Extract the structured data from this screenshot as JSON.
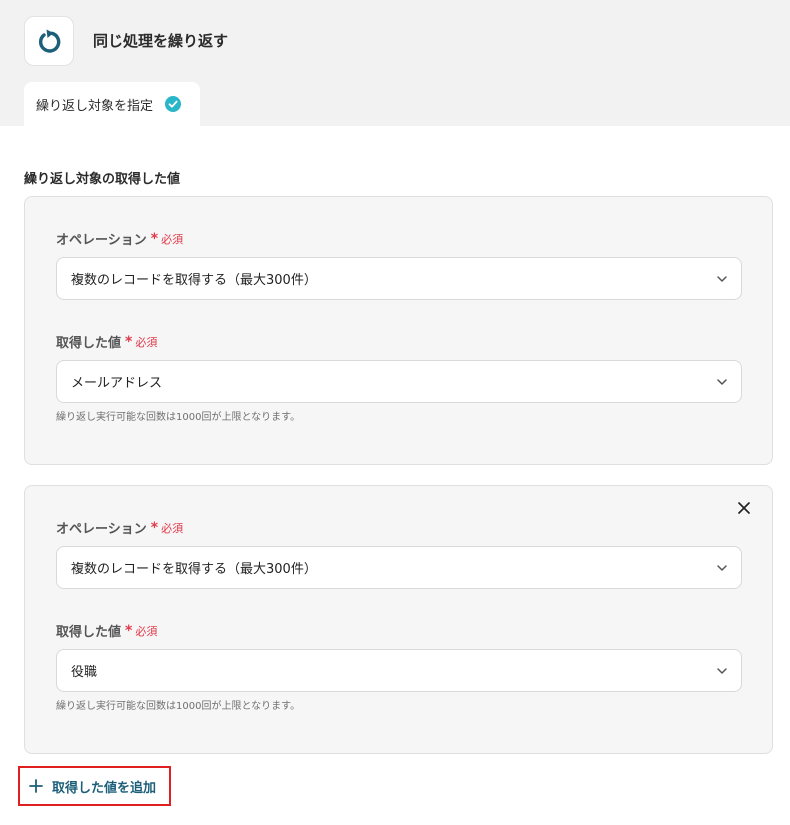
{
  "header": {
    "title": "同じ処理を繰り返す",
    "icon": "loop-arrow-icon",
    "tab_label": "繰り返し対象を指定",
    "tab_status_icon": "check-circle-icon"
  },
  "section": {
    "label": "繰り返し対象の取得した値"
  },
  "groups": [
    {
      "operation_label": "オペレーション",
      "operation_required": "必須",
      "operation_value": "複数のレコードを取得する（最大300件）",
      "value_label": "取得した値",
      "value_required": "必須",
      "value_value": "メールアドレス",
      "hint": "繰り返し実行可能な回数は1000回が上限となります。"
    },
    {
      "operation_label": "オペレーション",
      "operation_required": "必須",
      "operation_value": "複数のレコードを取得する（最大300件）",
      "value_label": "取得した値",
      "value_required": "必須",
      "value_value": "役職",
      "hint": "繰り返し実行可能な回数は1000回が上限となります。"
    }
  ],
  "add_button": {
    "label": "取得した値を追加"
  },
  "colors": {
    "accent": "#1d5f7a",
    "required": "#e0394a",
    "check": "#29b6c9",
    "highlight_border": "#e02020"
  }
}
